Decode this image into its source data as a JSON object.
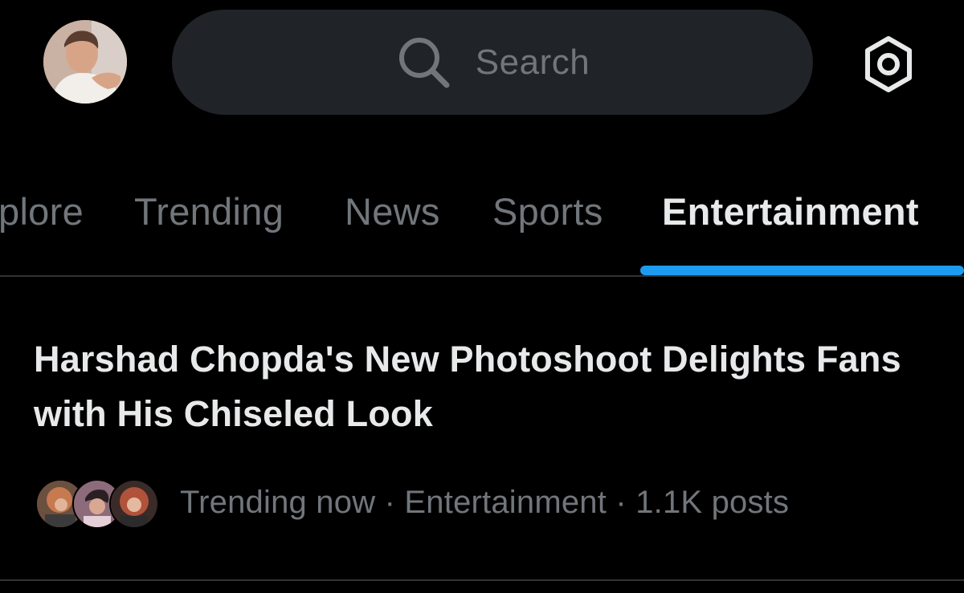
{
  "header": {
    "avatar_icon": "profile-avatar",
    "search": {
      "icon": "search-icon",
      "placeholder": "Search"
    },
    "settings_icon": "gear-icon"
  },
  "tabs": [
    {
      "label": "plore",
      "active": false
    },
    {
      "label": "Trending",
      "active": false
    },
    {
      "label": "News",
      "active": false
    },
    {
      "label": "Sports",
      "active": false
    },
    {
      "label": "Entertainment",
      "active": true
    }
  ],
  "trend": {
    "title": "Harshad Chopda's New Photoshoot Delights Fans with His Chiseled Look",
    "meta": "Trending now · Entertainment · 1.1K posts"
  },
  "colors": {
    "background": "#000000",
    "search_bg": "#202327",
    "muted_text": "#71767b",
    "primary_text": "#e7e9ea",
    "accent": "#1d9bf0",
    "divider": "#2f3336"
  }
}
